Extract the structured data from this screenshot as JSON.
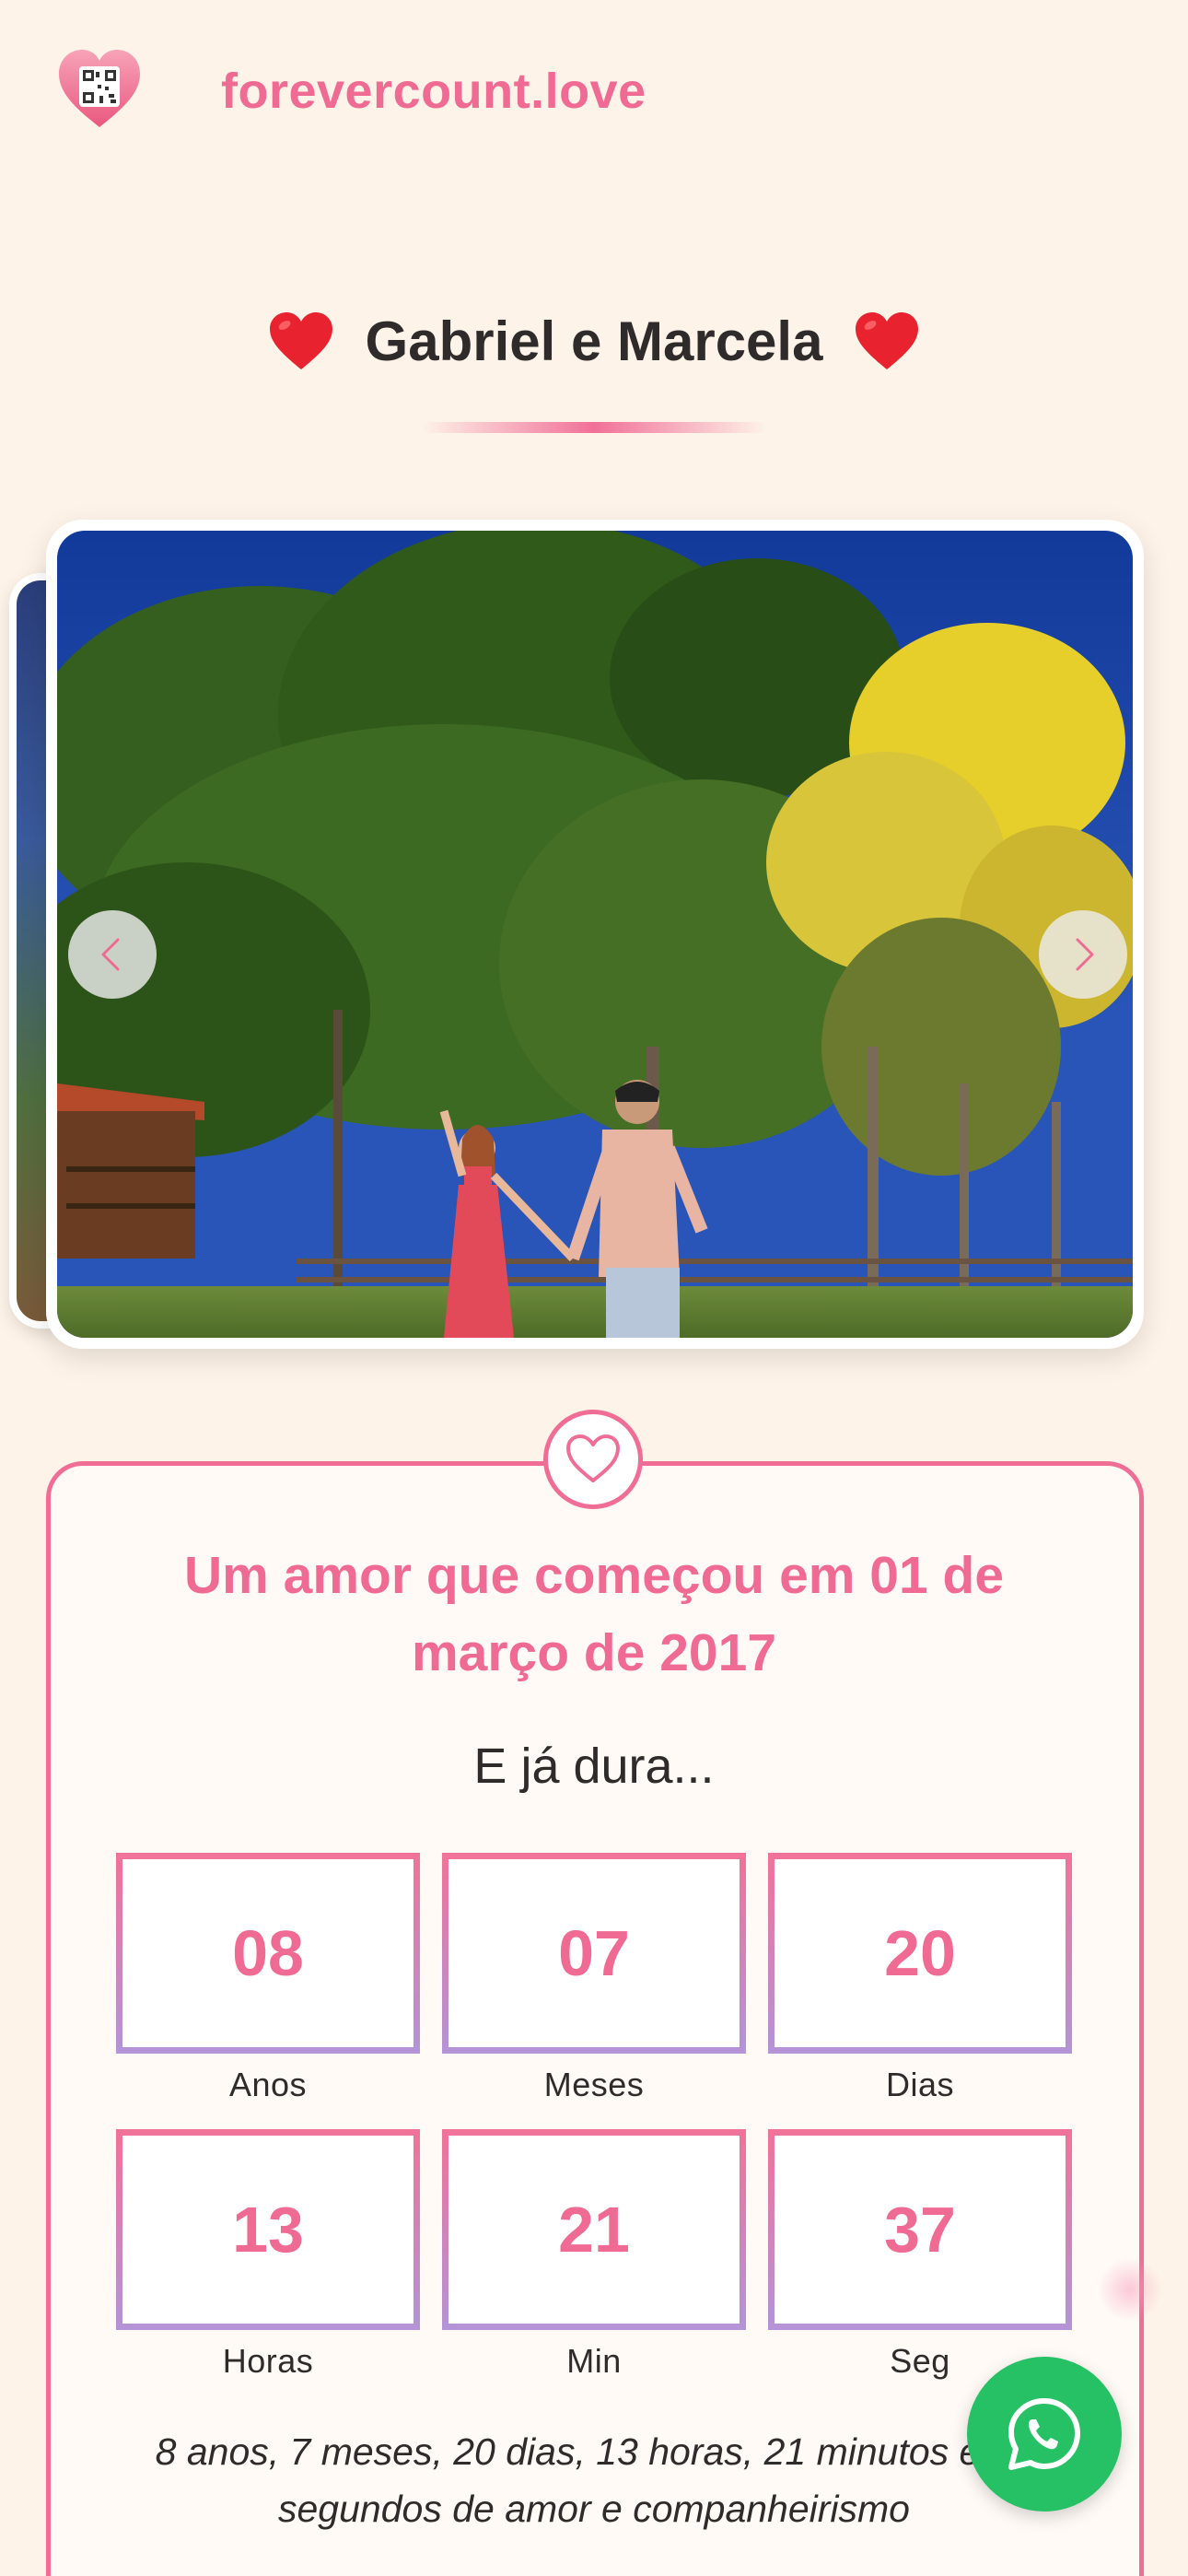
{
  "header": {
    "brand": "forevercount.love",
    "logo_icon": "heart-qr-icon"
  },
  "title": {
    "text": "Gabriel e Marcela",
    "left_icon": "red-heart-icon",
    "right_icon": "red-heart-icon"
  },
  "carousel": {
    "photo_alt": "Casal de mãos dadas em um parque com árvores e ipê amarelo",
    "prev_icon": "chevron-left-icon",
    "next_icon": "chevron-right-icon"
  },
  "counter": {
    "badge_icon": "heart-outline-icon",
    "since_text": "Um amor que começou em 01 de março de 2017",
    "subhead": "E já dura...",
    "units": [
      {
        "value": "08",
        "label": "Anos"
      },
      {
        "value": "07",
        "label": "Meses"
      },
      {
        "value": "20",
        "label": "Dias"
      },
      {
        "value": "13",
        "label": "Horas"
      },
      {
        "value": "21",
        "label": "Min"
      },
      {
        "value": "37",
        "label": "Seg"
      }
    ],
    "summary": "8 anos, 7 meses, 20 dias, 13 horas, 21 minutos e 37 segundos de amor e companheirismo"
  },
  "fab": {
    "icon": "whatsapp-icon"
  },
  "colors": {
    "background": "#fdf3e8",
    "accent": "#f06b93",
    "gradient_end": "#b493d6",
    "whatsapp": "#26c165"
  }
}
